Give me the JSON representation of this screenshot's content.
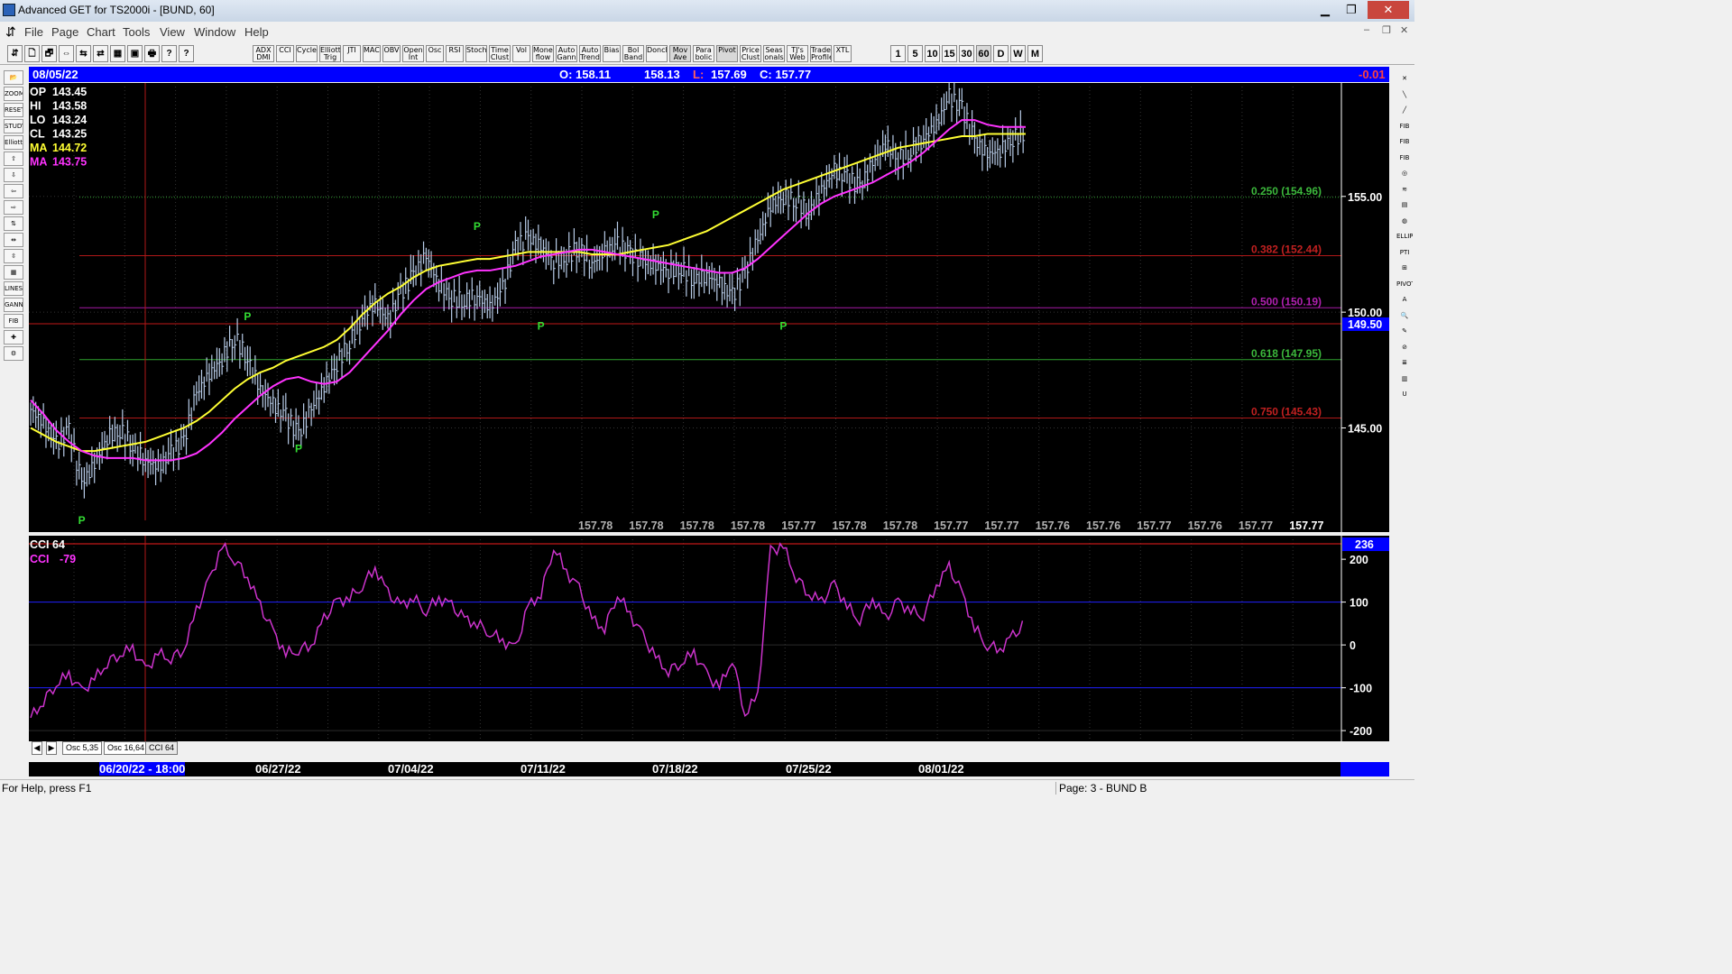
{
  "window": {
    "title": "Advanced GET for TS2000i - [BUND, 60]",
    "minimize": "▁",
    "restore": "❐",
    "close": "✕"
  },
  "menu": [
    "File",
    "Page",
    "Chart",
    "Tools",
    "View",
    "Window",
    "Help"
  ],
  "toolbar": {
    "indicators": [
      "ADX DMI",
      "CCI",
      "Cycles",
      "Elliott Trig",
      "JTI",
      "MACD",
      "OBV",
      "Open Int",
      "Osc",
      "RSI",
      "Stoch",
      "Time Clust",
      "Vol",
      "Money flow",
      "Auto Gann",
      "Auto Trend",
      "Bias",
      "Bol Band",
      "Donch",
      "Mov Ave",
      "Para bolic",
      "Pivot",
      "Price Clust",
      "Seas onals",
      "TJ's Web",
      "Trade Profile",
      "XTL"
    ],
    "timeframes": [
      "1",
      "5",
      "10",
      "15",
      "30",
      "60",
      "D",
      "W",
      "M"
    ],
    "selected_timeframe": "60"
  },
  "left_tools": [
    "📂",
    "ZOOM",
    "RESET",
    "STUDY",
    "Elliott",
    "⇧",
    "⇩",
    "⇦",
    "⇨",
    "⇅",
    "⇹",
    "⇳",
    "▦",
    "LINES",
    "GANN",
    "FIB",
    "✚",
    "⚙"
  ],
  "right_tools": [
    "✕",
    "╲",
    "╱",
    "FIB RET",
    "FIB EXT",
    "FIB TIME",
    "◎",
    "≋",
    "▤",
    "◍",
    "ELLIPS",
    "PTI",
    "⊞",
    "PIVOT",
    "A",
    "🔍",
    "✎",
    "⊘",
    "≣",
    "▥",
    "U"
  ],
  "infobar": {
    "date": "08/05/22",
    "open": "O: 158.11",
    "high": "158.13",
    "low_label": "L:",
    "low": "157.69",
    "close": "C: 157.77",
    "change": "-0.01"
  },
  "readout": {
    "op": {
      "label": "OP",
      "value": "143.45"
    },
    "hi": {
      "label": "HI",
      "value": "143.58"
    },
    "lo": {
      "label": "LO",
      "value": "143.24"
    },
    "cl": {
      "label": "CL",
      "value": "143.25"
    },
    "ma1": {
      "label": "MA",
      "value": "144.72"
    },
    "ma2": {
      "label": "MA",
      "value": "143.75"
    }
  },
  "fib_levels": [
    {
      "label": "0.250 (154.96)",
      "price": 154.96,
      "color": "#2ea22e",
      "text_color": "#3cb83c"
    },
    {
      "label": "0.382 (152.44)",
      "price": 152.44,
      "color": "#b01818",
      "text_color": "#c02020"
    },
    {
      "label": "0.500 (150.19)",
      "price": 150.19,
      "color": "#a418a4",
      "text_color": "#b020b0"
    },
    {
      "label": "0.618 (147.95)",
      "price": 147.95,
      "color": "#2ea22e",
      "text_color": "#3cb83c"
    },
    {
      "label": "0.750 (145.43)",
      "price": 145.43,
      "color": "#b01818",
      "text_color": "#c02020"
    }
  ],
  "price_axis": {
    "ticks": [
      "155.00",
      "150.00",
      "145.00"
    ],
    "tick_values": [
      155,
      150,
      145
    ],
    "current": "149.50",
    "current_value": 149.5
  },
  "price_row": [
    "157.78",
    "157.78",
    "157.78",
    "157.78",
    "157.77",
    "157.78",
    "157.78",
    "157.77",
    "157.77",
    "157.76",
    "157.76",
    "157.77",
    "157.76",
    "157.77",
    "157.77"
  ],
  "pivots": [
    {
      "label": "P",
      "price": 141.4,
      "bar": 4
    },
    {
      "label": "P",
      "price": 149.5,
      "bar": 17
    },
    {
      "label": "P",
      "price": 144.5,
      "bar": 21
    },
    {
      "label": "P",
      "price": 153.4,
      "bar": 35
    },
    {
      "label": "P",
      "price": 149.8,
      "bar": 40
    },
    {
      "label": "P",
      "price": 153.9,
      "bar": 49
    },
    {
      "label": "P",
      "price": 149.8,
      "bar": 59
    }
  ],
  "price_series": [
    145.8,
    145.2,
    144.3,
    144.9,
    142.6,
    143.4,
    144.6,
    144.9,
    144.2,
    143.6,
    143.3,
    143.9,
    144.4,
    146.5,
    147.3,
    148.0,
    148.9,
    148.0,
    146.7,
    146.0,
    145.5,
    144.7,
    145.8,
    146.8,
    147.8,
    148.7,
    149.8,
    150.4,
    149.6,
    150.8,
    151.6,
    152.4,
    151.2,
    150.6,
    150.5,
    150.7,
    150.2,
    151.0,
    152.8,
    153.2,
    152.8,
    152.2,
    152.4,
    152.8,
    152.1,
    152.6,
    152.9,
    152.5,
    152.2,
    152.0,
    151.8,
    151.9,
    151.4,
    151.6,
    151.2,
    150.7,
    151.7,
    153.1,
    154.6,
    155.0,
    154.8,
    154.3,
    155.3,
    156.1,
    155.8,
    155.4,
    156.4,
    157.3,
    156.6,
    157.0,
    157.5,
    158.1,
    159.3,
    158.8,
    157.4,
    156.8,
    157.0,
    157.5,
    157.8
  ],
  "moving_averages": [
    {
      "name": "MA",
      "color": "#ffff33",
      "values": [
        145.0,
        144.7,
        144.4,
        144.2,
        144.0,
        144.0,
        144.1,
        144.2,
        144.3,
        144.4,
        144.6,
        144.8,
        145.0,
        145.3,
        145.7,
        146.2,
        146.7,
        147.1,
        147.4,
        147.6,
        147.9,
        148.1,
        148.3,
        148.5,
        148.8,
        149.3,
        149.9,
        150.4,
        150.8,
        151.1,
        151.5,
        151.8,
        152.0,
        152.1,
        152.2,
        152.3,
        152.3,
        152.4,
        152.5,
        152.6,
        152.6,
        152.6,
        152.6,
        152.6,
        152.5,
        152.5,
        152.5,
        152.6,
        152.7,
        152.8,
        152.9,
        153.1,
        153.3,
        153.5,
        153.8,
        154.1,
        154.4,
        154.7,
        155.0,
        155.3,
        155.5,
        155.7,
        155.9,
        156.1,
        156.3,
        156.5,
        156.7,
        156.9,
        157.1,
        157.2,
        157.3,
        157.4,
        157.5,
        157.6,
        157.6,
        157.7,
        157.7,
        157.7,
        157.7
      ]
    },
    {
      "name": "MA",
      "color": "#ff33ff",
      "values": [
        146.2,
        145.6,
        144.9,
        144.4,
        144.0,
        143.8,
        143.7,
        143.7,
        143.7,
        143.6,
        143.6,
        143.6,
        143.7,
        143.9,
        144.3,
        144.8,
        145.4,
        145.9,
        146.4,
        146.8,
        147.1,
        147.2,
        147.0,
        146.9,
        147.0,
        147.4,
        148.0,
        148.6,
        149.2,
        149.9,
        150.5,
        151.0,
        151.3,
        151.5,
        151.7,
        151.8,
        151.8,
        151.9,
        152.0,
        152.2,
        152.4,
        152.5,
        152.6,
        152.7,
        152.7,
        152.6,
        152.5,
        152.4,
        152.3,
        152.2,
        152.1,
        152.0,
        151.9,
        151.8,
        151.7,
        151.7,
        151.9,
        152.3,
        152.8,
        153.3,
        153.8,
        154.3,
        154.7,
        155.0,
        155.2,
        155.4,
        155.6,
        155.9,
        156.2,
        156.5,
        156.9,
        157.4,
        157.9,
        158.3,
        158.3,
        158.1,
        158.0,
        158.0,
        158.0
      ]
    }
  ],
  "cci": {
    "title": "CCI 64",
    "value_label": "CCI",
    "value": "-79",
    "axis_current": "236",
    "ticks": [
      "200",
      "100",
      "0",
      "-100",
      "-200"
    ],
    "tick_values": [
      200,
      100,
      0,
      -100,
      -200
    ],
    "values": [
      -170,
      -130,
      -90,
      -70,
      -110,
      -80,
      -40,
      -20,
      -10,
      -60,
      -20,
      -30,
      -10,
      80,
      150,
      230,
      200,
      160,
      90,
      30,
      -20,
      -10,
      0,
      60,
      100,
      110,
      140,
      180,
      120,
      90,
      110,
      80,
      110,
      90,
      60,
      50,
      30,
      10,
      -10,
      90,
      120,
      230,
      170,
      130,
      60,
      40,
      120,
      70,
      20,
      -30,
      -60,
      -40,
      -20,
      -70,
      -100,
      -30,
      -160,
      -120,
      220,
      230,
      160,
      120,
      100,
      140,
      90,
      60,
      110,
      60,
      100,
      80,
      70,
      140,
      180,
      120,
      40,
      0,
      -10,
      20,
      50
    ]
  },
  "dates": [
    "06/20/22 - 18:00",
    "06/27/22",
    "07/04/22",
    "07/11/22",
    "07/18/22",
    "07/25/22",
    "08/01/22"
  ],
  "tabs": [
    "Osc 5,35",
    "Osc 16,64",
    "CCI 64"
  ],
  "tab_nav": [
    "◀",
    "▶"
  ],
  "status": {
    "help": "For Help, press F1",
    "page": "Page: 3 - BUND B"
  }
}
